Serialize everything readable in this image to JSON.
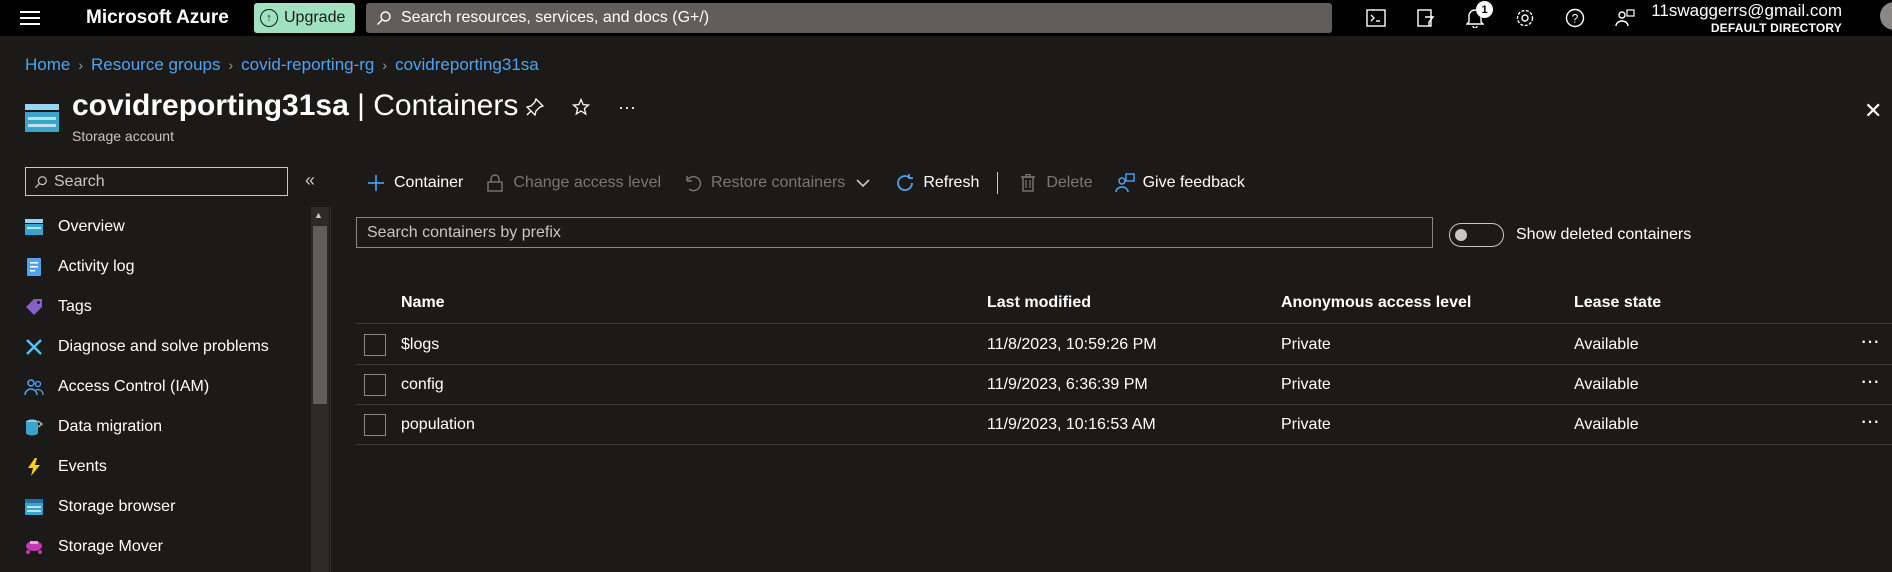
{
  "topbar": {
    "brand": "Microsoft Azure",
    "upgrade_label": "Upgrade",
    "search_placeholder": "Search resources, services, and docs (G+/)",
    "notification_count": "1",
    "account_email": "11swaggerrs@gmail.com",
    "account_directory": "DEFAULT DIRECTORY"
  },
  "breadcrumb": {
    "items": [
      "Home",
      "Resource groups",
      "covid-reporting-rg",
      "covidreporting31sa"
    ]
  },
  "header": {
    "resource_name": "covidreporting31sa",
    "separator": " | ",
    "section": "Containers",
    "subtitle": "Storage account"
  },
  "sidebar": {
    "search_placeholder": "Search",
    "collapse_glyph": "«",
    "items": [
      {
        "label": "Overview",
        "icon": "overview-icon"
      },
      {
        "label": "Activity log",
        "icon": "activity-log-icon"
      },
      {
        "label": "Tags",
        "icon": "tag-icon"
      },
      {
        "label": "Diagnose and solve problems",
        "icon": "wrench-icon"
      },
      {
        "label": "Access Control (IAM)",
        "icon": "people-icon"
      },
      {
        "label": "Data migration",
        "icon": "data-migration-icon"
      },
      {
        "label": "Events",
        "icon": "lightning-icon"
      },
      {
        "label": "Storage browser",
        "icon": "storage-browser-icon"
      },
      {
        "label": "Storage Mover",
        "icon": "storage-mover-icon"
      }
    ]
  },
  "toolbar": {
    "add_container": "Container",
    "change_access": "Change access level",
    "restore": "Restore containers",
    "refresh": "Refresh",
    "delete": "Delete",
    "feedback": "Give feedback"
  },
  "filter": {
    "placeholder": "Search containers by prefix",
    "toggle_label": "Show deleted containers"
  },
  "table": {
    "columns": [
      "Name",
      "Last modified",
      "Anonymous access level",
      "Lease state"
    ],
    "rows": [
      {
        "name": "$logs",
        "modified": "11/8/2023, 10:59:26 PM",
        "access": "Private",
        "lease": "Available"
      },
      {
        "name": "config",
        "modified": "11/9/2023, 6:36:39 PM",
        "access": "Private",
        "lease": "Available"
      },
      {
        "name": "population",
        "modified": "11/9/2023, 10:16:53 AM",
        "access": "Private",
        "lease": "Available"
      }
    ]
  },
  "colors": {
    "accent": "#4fa3f0",
    "upgrade": "#9fe2bf",
    "background": "#1b1a19"
  }
}
